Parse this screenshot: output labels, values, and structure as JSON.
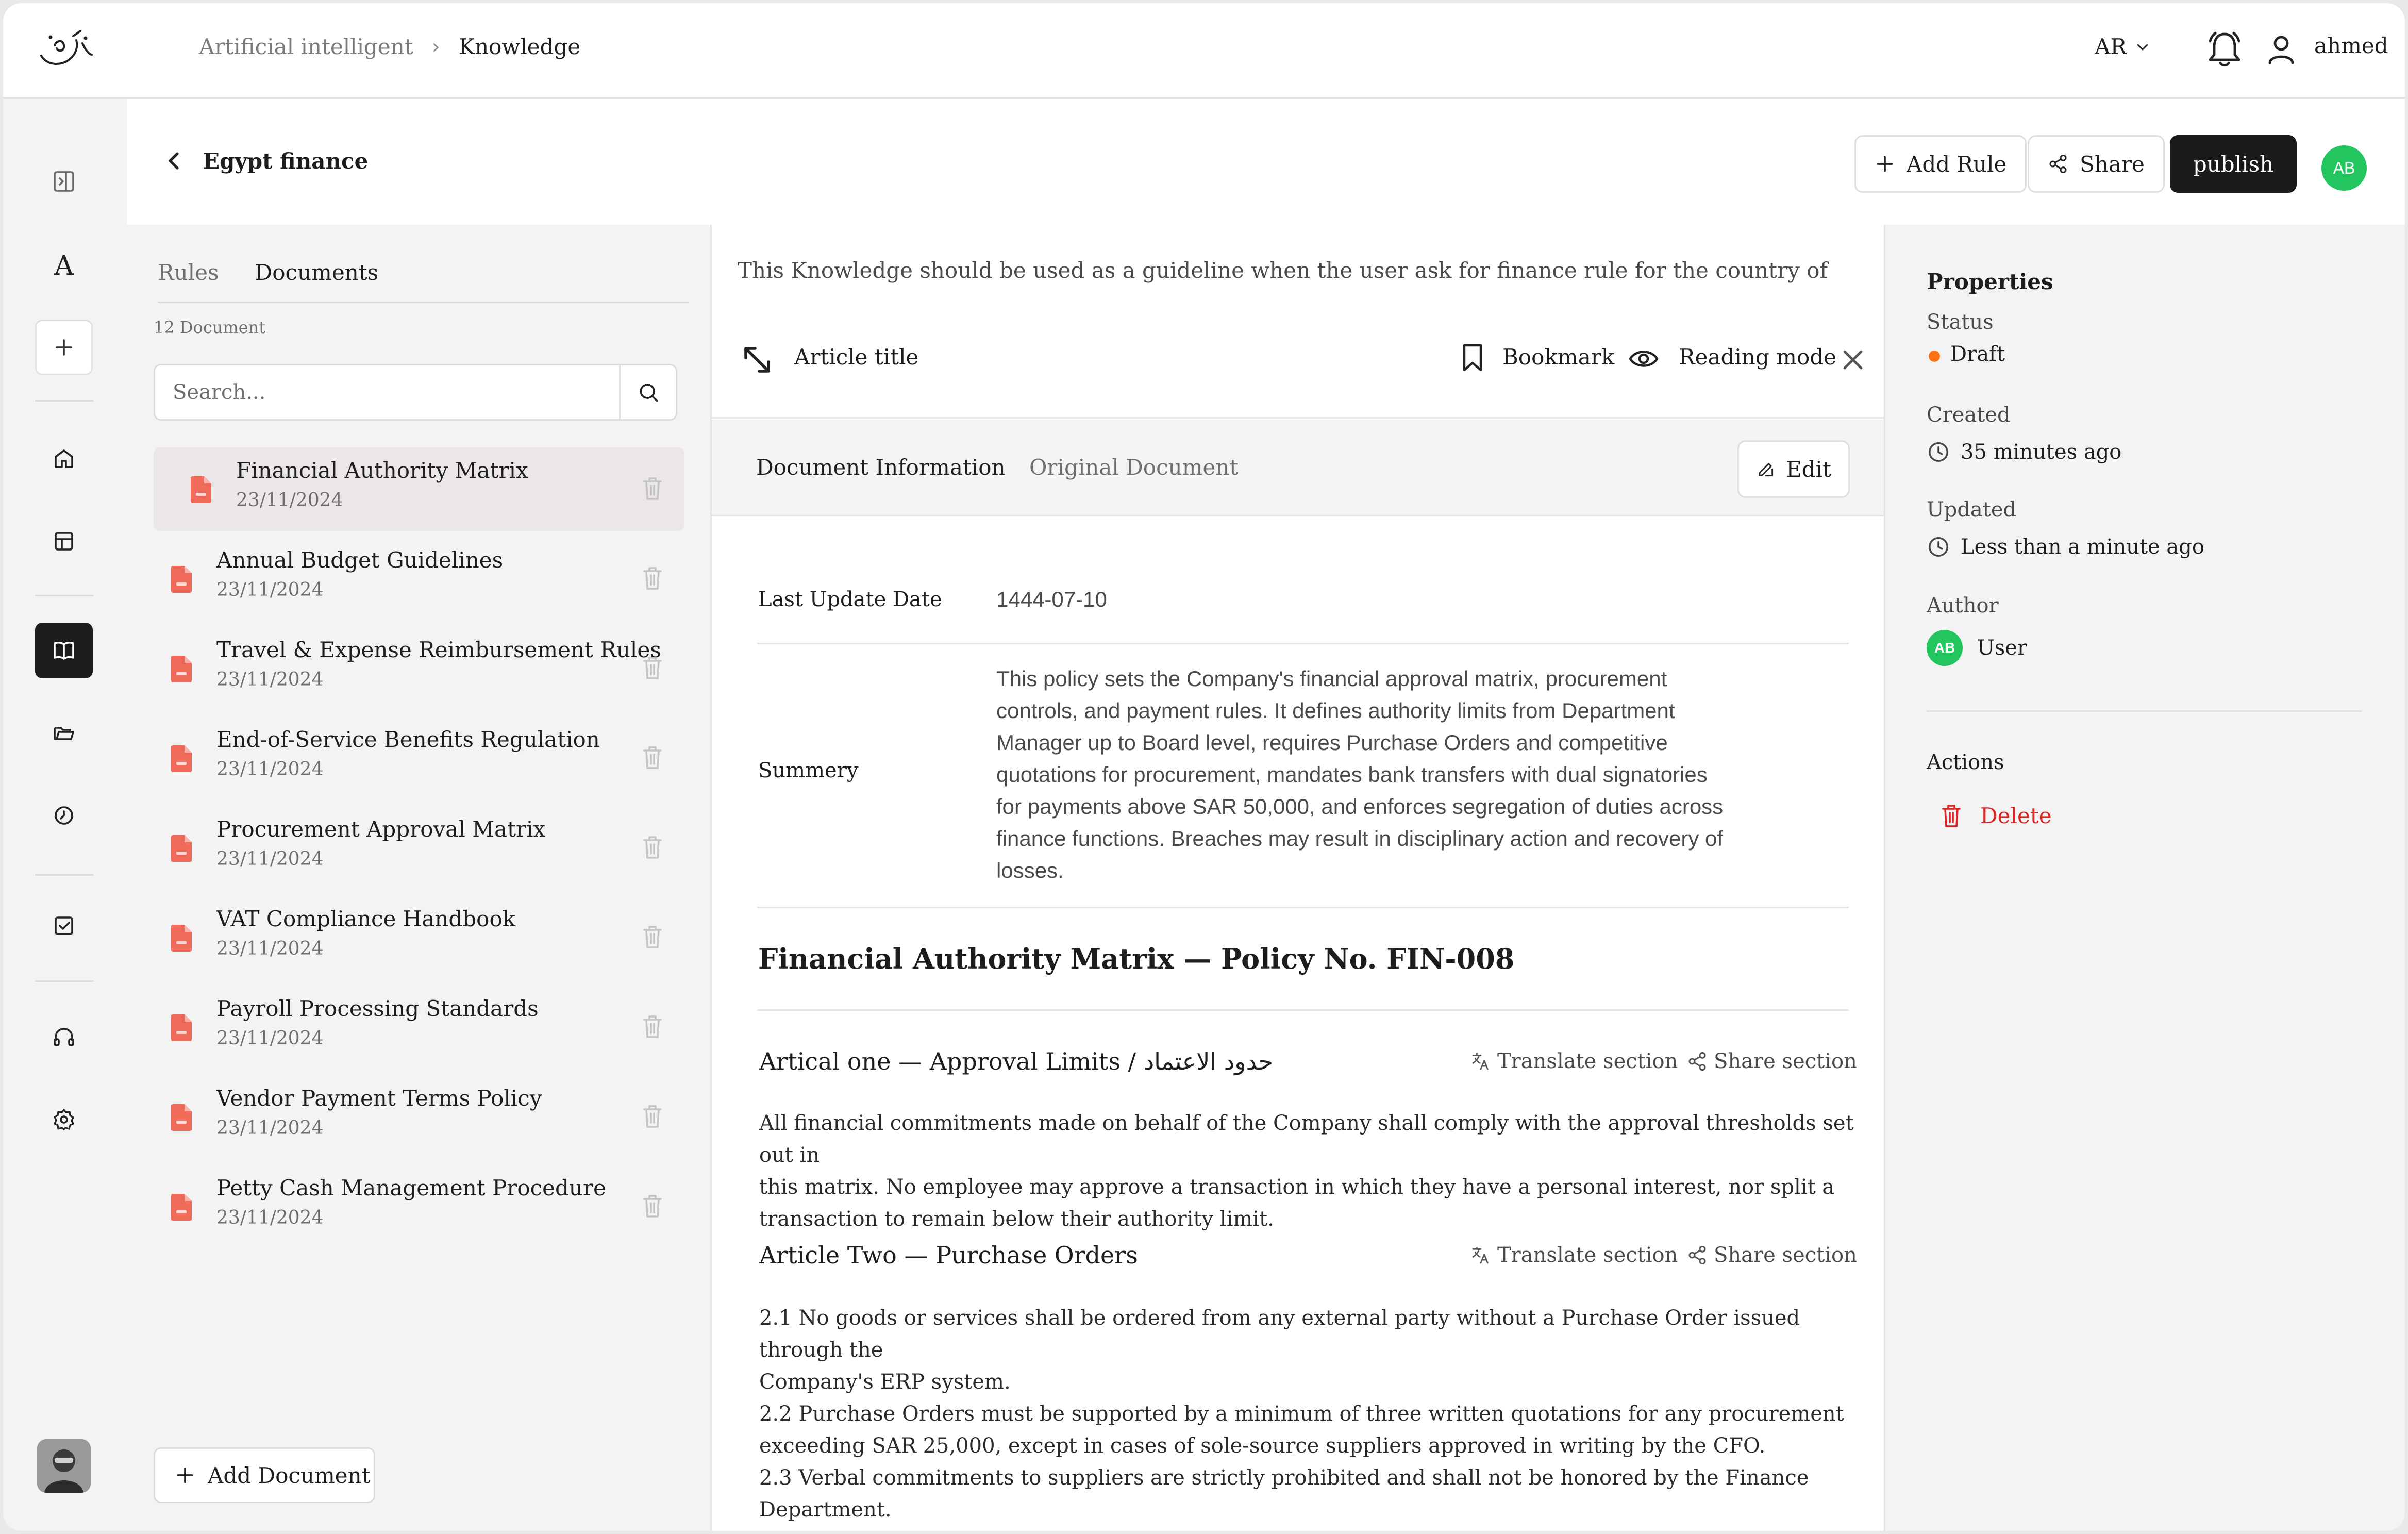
{
  "header": {
    "breadcrumb": [
      "Artificial intelligent",
      "Knowledge"
    ],
    "language": "AR",
    "user_name": "ahmed"
  },
  "page": {
    "title": "Egypt finance",
    "buttons": {
      "add_rule": "Add Rule",
      "share": "Share",
      "publish": "publish"
    },
    "avatar_initials": "AB"
  },
  "documents_panel": {
    "tabs": [
      "Rules",
      "Documents"
    ],
    "active_tab": "Documents",
    "count_label": "12 Document",
    "search_placeholder": "Search...",
    "items": [
      {
        "name": "Financial Authority Matrix",
        "date": "23/11/2024",
        "selected": true
      },
      {
        "name": "Annual Budget Guidelines",
        "date": "23/11/2024"
      },
      {
        "name": "Travel & Expense Reimbursement Rules",
        "date": "23/11/2024"
      },
      {
        "name": "End-of-Service Benefits Regulation",
        "date": "23/11/2024"
      },
      {
        "name": "Procurement Approval Matrix",
        "date": "23/11/2024"
      },
      {
        "name": "VAT Compliance Handbook",
        "date": "23/11/2024"
      },
      {
        "name": "Payroll Processing Standards",
        "date": "23/11/2024"
      },
      {
        "name": "Vendor Payment Terms Policy",
        "date": "23/11/2024"
      },
      {
        "name": "Petty Cash Management Procedure",
        "date": "23/11/2024"
      }
    ],
    "add_document": "Add Document"
  },
  "article": {
    "guideline": "This Knowledge should be used as a guideline when the user ask for finance rule for the country of",
    "title": "Article title",
    "bookmark": "Bookmark",
    "reading_mode": "Reading mode",
    "info_tabs": [
      "Document Information",
      "Original Document"
    ],
    "edit": "Edit",
    "last_update_label": "Last Update Date",
    "last_update_value": "1444-07-10",
    "summary_label": "Summery",
    "summary_lines": [
      "This policy sets the Company's financial approval matrix, procurement",
      "controls, and payment rules. It defines authority limits from Department",
      "Manager up to Board level, requires Purchase Orders and competitive",
      "quotations for procurement, mandates bank transfers with dual signatories",
      "for payments above SAR 50,000, and enforces segregation of duties across",
      "finance functions. Breaches may result in disciplinary action and recovery of",
      "losses."
    ],
    "policy_heading": "Financial Authority Matrix — Policy No. FIN-008",
    "translate_label": "Translate section",
    "share_section_label": "Share section",
    "sections": [
      {
        "heading": "Artical one — Approval Limits / حدود الاعتماد",
        "lines": [
          "All financial commitments made on behalf of the Company shall comply with the approval thresholds set out in",
          "this matrix. No employee may approve a transaction in which they have a personal interest, nor split a",
          "transaction to remain below their authority limit."
        ]
      },
      {
        "heading": "Article Two — Purchase Orders",
        "lines": [
          "2.1 No goods or services shall be ordered from any external party without a Purchase Order issued through the",
          "Company's ERP system.",
          "2.2 Purchase Orders must be supported by a minimum of three written quotations for any procurement",
          "exceeding SAR 25,000, except in cases of sole-source suppliers approved in writing by the CFO.",
          "2.3 Verbal commitments to suppliers are strictly prohibited and shall not be honored by the Finance",
          "Department."
        ]
      }
    ]
  },
  "properties": {
    "heading": "Properties",
    "status_label": "Status",
    "status_value": "Draft",
    "created_label": "Created",
    "created_value": "35 minutes ago",
    "updated_label": "Updated",
    "updated_value": "Less than a minute ago",
    "author_label": "Author",
    "author_initials": "AB",
    "author_value": "User",
    "actions_label": "Actions",
    "delete_label": "Delete"
  },
  "colors": {
    "accent_dark": "#1a1a1a",
    "avatar_green": "#22c55e",
    "status_orange": "#f97316",
    "danger_red": "#dc2626",
    "file_icon_red": "#f06a5a"
  }
}
